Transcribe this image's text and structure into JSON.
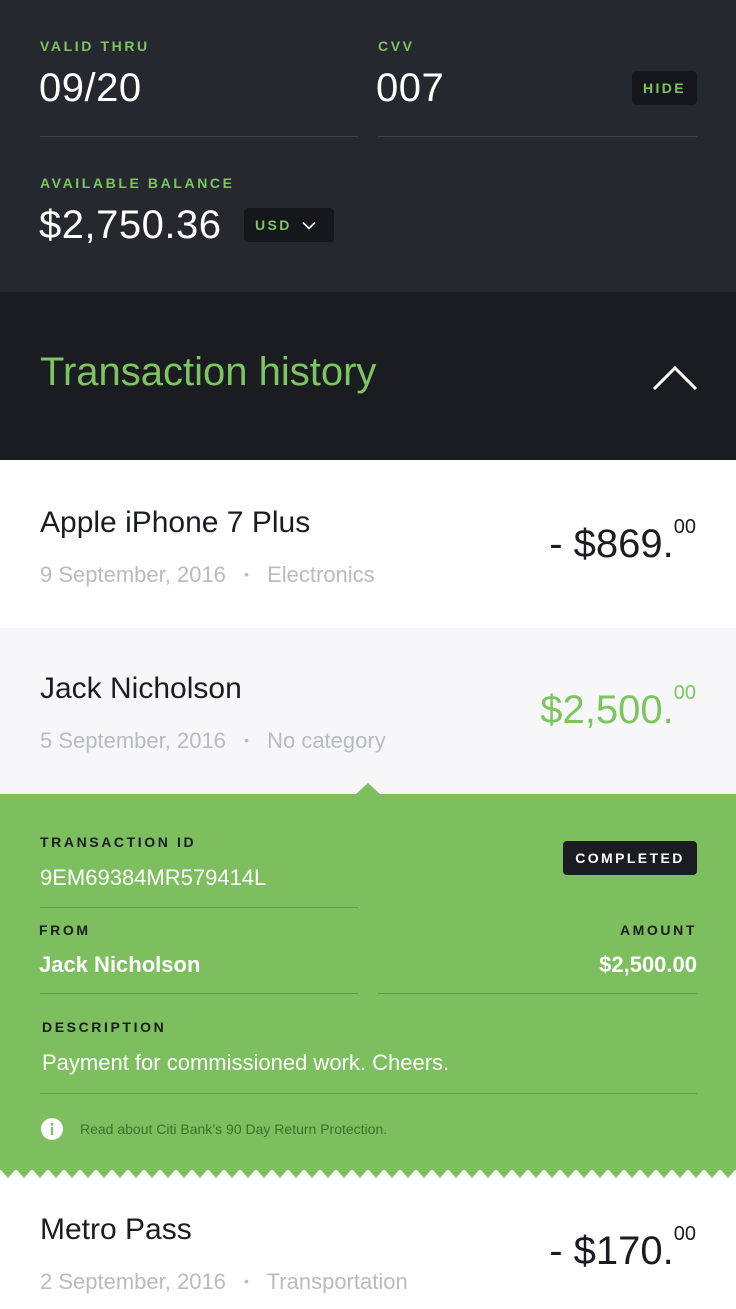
{
  "card": {
    "valid_thru_label": "VALID THRU",
    "valid_thru_value": "09/20",
    "cvv_label": "CVV",
    "cvv_value": "007",
    "hide_button": "HIDE",
    "balance_label": "AVAILABLE BALANCE",
    "balance_value": "$2,750.36",
    "currency": "USD"
  },
  "history": {
    "title": "Transaction history"
  },
  "transactions": [
    {
      "name": "Apple iPhone 7 Plus",
      "date": "9 September, 2016",
      "category": "Electronics",
      "amount_main": "- $869.",
      "amount_cents": "00",
      "type": "debit"
    },
    {
      "name": "Jack Nicholson",
      "date": "5 September, 2016",
      "category": "No category",
      "amount_main": "$2,500.",
      "amount_cents": "00",
      "type": "credit"
    },
    {
      "name": "Metro Pass",
      "date": "2 September, 2016",
      "category": "Transportation",
      "amount_main": "- $170.",
      "amount_cents": "00",
      "type": "debit"
    }
  ],
  "details": {
    "transaction_id_label": "TRANSACTION ID",
    "transaction_id": "9EM69384MR579414L",
    "status": "COMPLETED",
    "from_label": "FROM",
    "from_value": "Jack Nicholson",
    "amount_label": "AMOUNT",
    "amount_value": "$2,500.00",
    "description_label": "DESCRIPTION",
    "description_value": "Payment for commissioned work. Cheers.",
    "info_text": "Read about Citi Bank’s 90 Day Return Protection."
  },
  "separator": "•",
  "colors": {
    "accent_green": "#7dc55f",
    "panel_green": "#7dbf5f",
    "dark_bg": "#262830",
    "darker_bg": "#1b1c22",
    "muted_text": "#b9bbc2"
  }
}
